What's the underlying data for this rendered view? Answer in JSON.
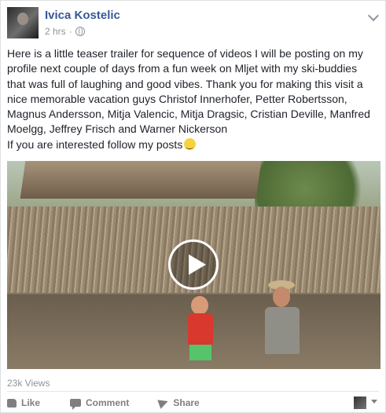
{
  "post": {
    "author": "Ivica Kostelic",
    "time": "2 hrs",
    "separator": "·",
    "text": "Here is a little teaser trailer for sequence of videos I will be posting on my profile next couple of days from a fun week on Mljet with my ski-buddies that was full of laughing and good vibes. Thank you for making this visit a nice memorable vacation guys Christof Innerhofer, Petter Robertsson, Magnus Andersson, Mitja Valencic, Mitja Dragsic, Cristian Deville, Manfred Moelgg, Jeffrey Frisch and Warner Nickerson\nIf you are interested follow my posts",
    "views": "23k Views"
  },
  "actions": {
    "like": "Like",
    "comment": "Comment",
    "share": "Share"
  },
  "icons": [
    "globe-icon",
    "chevron-down-icon",
    "play-icon",
    "like-icon",
    "comment-icon",
    "share-icon",
    "smiley-emoji-icon"
  ],
  "colors": {
    "author": "#365899",
    "meta": "#90949c",
    "action": "#7f7f7f"
  }
}
